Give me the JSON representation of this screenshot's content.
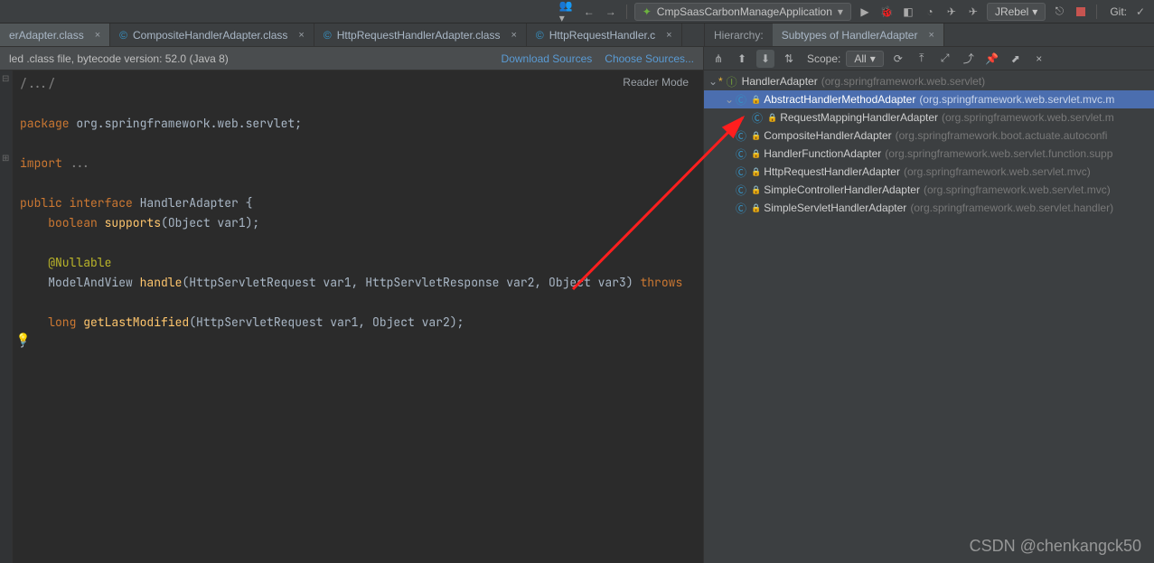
{
  "toolbar": {
    "run_config": "CmpSaasCarbonManageApplication",
    "jrebel": "JRebel",
    "git_label": "Git:"
  },
  "tabs": {
    "editor": [
      {
        "label": "erAdapter.class"
      },
      {
        "label": "CompositeHandlerAdapter.class"
      },
      {
        "label": "HttpRequestHandlerAdapter.class"
      },
      {
        "label": "HttpRequestHandler.c"
      }
    ],
    "hierarchy_label": "Hierarchy:",
    "hierarchy_tab": "Subtypes of HandlerAdapter"
  },
  "decompile": {
    "msg": "led .class file, bytecode version: 52.0 (Java 8)",
    "download": "Download Sources",
    "choose": "Choose Sources..."
  },
  "readerMode": "Reader Mode",
  "code": {
    "l1": "/.../",
    "pkg_kw": "package ",
    "pkg": "org.springframework.web.servlet",
    "imp_kw": "import ",
    "imp_dots": "...",
    "pub": "public ",
    "iface": "interface ",
    "name": "HandlerAdapter ",
    "brace": "{",
    "bool": "    boolean ",
    "supports": "supports",
    "supports_sig": "(Object var1)",
    "semi": ";",
    "nullable": "    @Nullable",
    "mav": "    ModelAndView ",
    "handle": "handle",
    "handle_sig": "(HttpServletRequest var1, HttpServletResponse var2, Object var3) ",
    "throws": "throws",
    "long": "    long ",
    "glm": "getLastModified",
    "glm_sig": "(HttpServletRequest var1, Object var2)",
    "close": "}"
  },
  "hierarchy": {
    "scope_label": "Scope:",
    "scope_value": "All",
    "tree": [
      {
        "indent": 0,
        "chev": "⌄",
        "icon": "iface",
        "star": true,
        "name": "HandlerAdapter",
        "pkg": "(org.springframework.web.servlet)"
      },
      {
        "indent": 1,
        "chev": "⌄",
        "icon": "class",
        "lock": true,
        "name": "AbstractHandlerMethodAdapter",
        "pkg": "(org.springframework.web.servlet.mvc.m",
        "selected": true
      },
      {
        "indent": 2,
        "chev": "",
        "icon": "class",
        "lock": true,
        "name": "RequestMappingHandlerAdapter",
        "pkg": "(org.springframework.web.servlet.m"
      },
      {
        "indent": 1,
        "chev": "",
        "icon": "class",
        "lock": true,
        "name": "CompositeHandlerAdapter",
        "pkg": "(org.springframework.boot.actuate.autoconfi"
      },
      {
        "indent": 1,
        "chev": "",
        "icon": "class",
        "lock": true,
        "name": "HandlerFunctionAdapter",
        "pkg": "(org.springframework.web.servlet.function.supp"
      },
      {
        "indent": 1,
        "chev": "",
        "icon": "class",
        "lock": true,
        "name": "HttpRequestHandlerAdapter",
        "pkg": "(org.springframework.web.servlet.mvc)"
      },
      {
        "indent": 1,
        "chev": "",
        "icon": "class",
        "lock": true,
        "name": "SimpleControllerHandlerAdapter",
        "pkg": "(org.springframework.web.servlet.mvc)"
      },
      {
        "indent": 1,
        "chev": "",
        "icon": "class",
        "lock": true,
        "name": "SimpleServletHandlerAdapter",
        "pkg": "(org.springframework.web.servlet.handler)"
      }
    ]
  },
  "watermark": "CSDN @chenkangck50"
}
